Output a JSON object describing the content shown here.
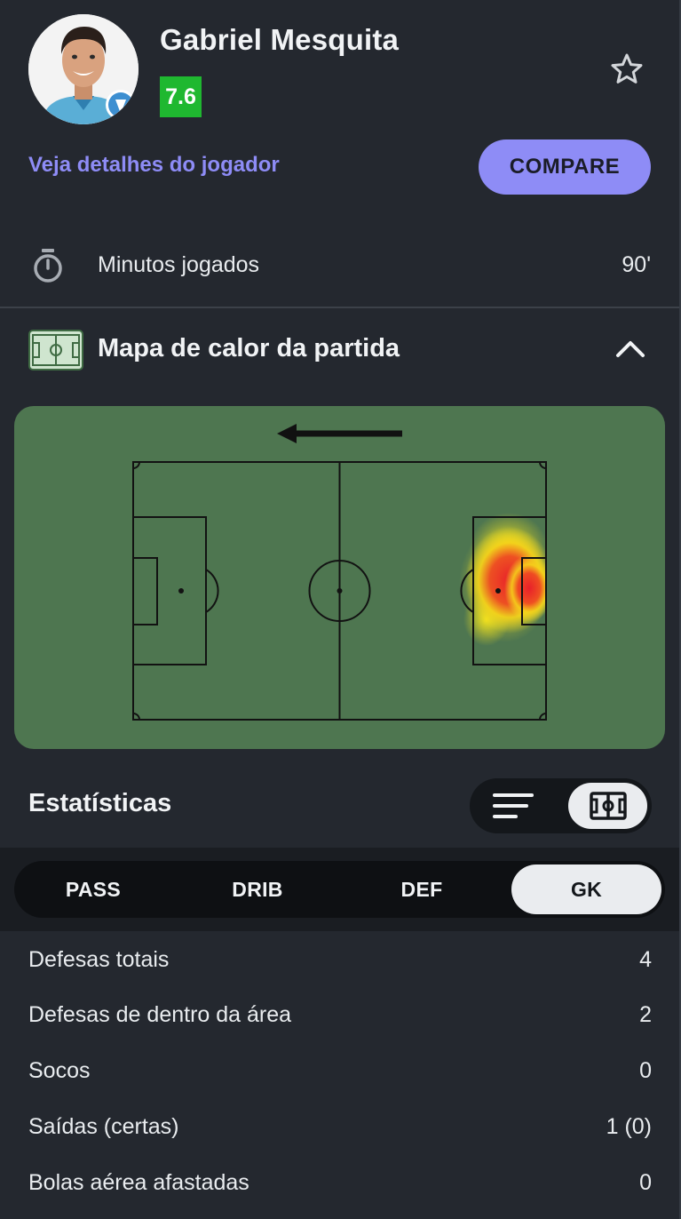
{
  "player": {
    "name": "Gabriel Mesquita",
    "rating": "7.6",
    "details_link": "Veja detalhes do jogador",
    "compare_label": "COMPARE"
  },
  "minutes": {
    "label": "Minutos jogados",
    "value": "90'"
  },
  "heatmap": {
    "title": "Mapa de calor da partida",
    "attack_direction": "left"
  },
  "statistics": {
    "title": "Estatísticas",
    "tabs": [
      "PASS",
      "DRIB",
      "DEF",
      "GK"
    ],
    "active_tab": "GK",
    "rows": [
      {
        "label": "Defesas totais",
        "value": "4"
      },
      {
        "label": "Defesas de dentro da área",
        "value": "2"
      },
      {
        "label": "Socos",
        "value": "0"
      },
      {
        "label": "Saídas (certas)",
        "value": "1 (0)"
      },
      {
        "label": "Bolas aérea afastadas",
        "value": "0"
      }
    ]
  },
  "icons": {
    "favorite": "star-outline-icon",
    "minutes": "stopwatch-icon",
    "heatmap": "pitch-icon",
    "collapse": "chevron-up-icon",
    "list_view": "list-icon",
    "pitch_view": "pitch-view-icon"
  },
  "colors": {
    "background": "#24282f",
    "accent": "#8e8cf6",
    "rating": "#1fb830",
    "pitch": "#4e7650"
  }
}
